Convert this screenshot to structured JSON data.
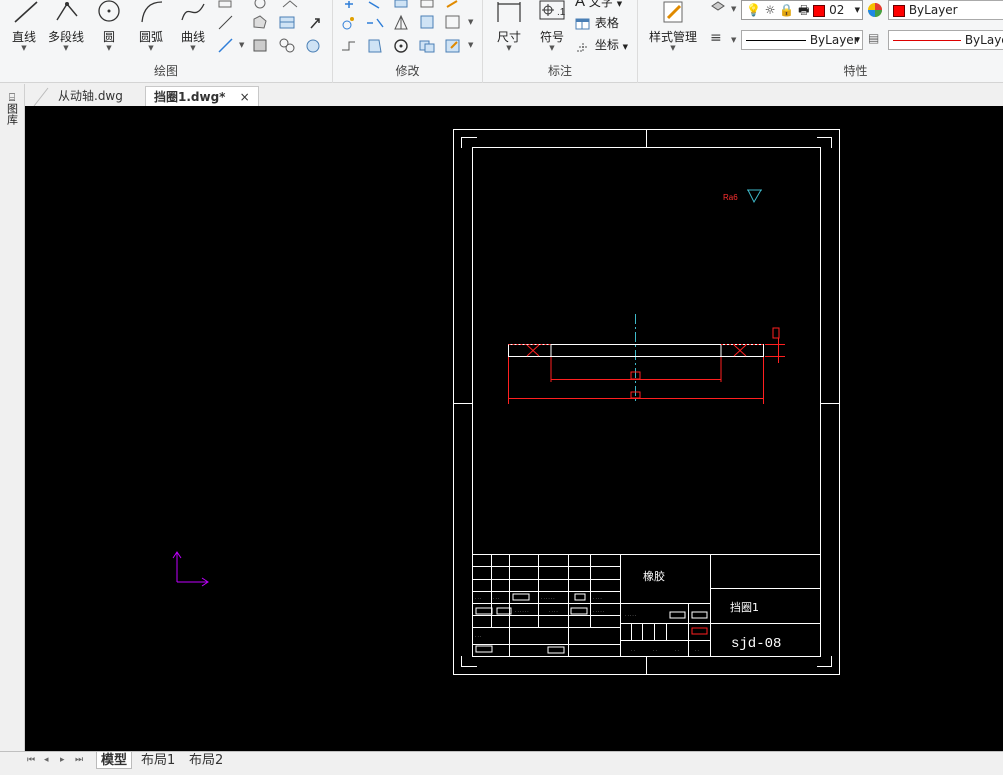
{
  "ribbon": {
    "draw_panel": {
      "label": "绘图",
      "line_label": "直线",
      "polyline_label": "多段线",
      "circle_label": "圆",
      "arc_label": "圆弧",
      "curve_label": "曲线"
    },
    "modify_panel": {
      "label": "修改"
    },
    "annotate_panel": {
      "label": "标注",
      "dimension_label": "尺寸",
      "symbol_label": "符号",
      "text_label": "文字",
      "table_label": "表格",
      "coord_label": "坐标"
    },
    "style_panel": {
      "label": "样式管理"
    },
    "props_panel": {
      "label": "特性",
      "layer_value": "02",
      "color_value": "ByLayer",
      "linetype_value": "ByLayer",
      "lineweight_value": "ByLayer"
    }
  },
  "tabs": [
    {
      "label": "从动轴.dwg"
    },
    {
      "label": "挡圈1.dwg*"
    }
  ],
  "left_panel_label": "图库",
  "layout_tabs": [
    {
      "label": "模型"
    },
    {
      "label": "布局1"
    },
    {
      "label": "布局2"
    }
  ],
  "drawing": {
    "title_block": {
      "material": "橡胶",
      "part_name": "挡圈1",
      "drawing_number": "sjd-08"
    }
  },
  "colors": {
    "canvas": "#000000",
    "drawing_line": "#ffffff",
    "dimension": "#ff2020",
    "centerline": "#3fb9c9",
    "ucs_icon": "#c000ff"
  }
}
